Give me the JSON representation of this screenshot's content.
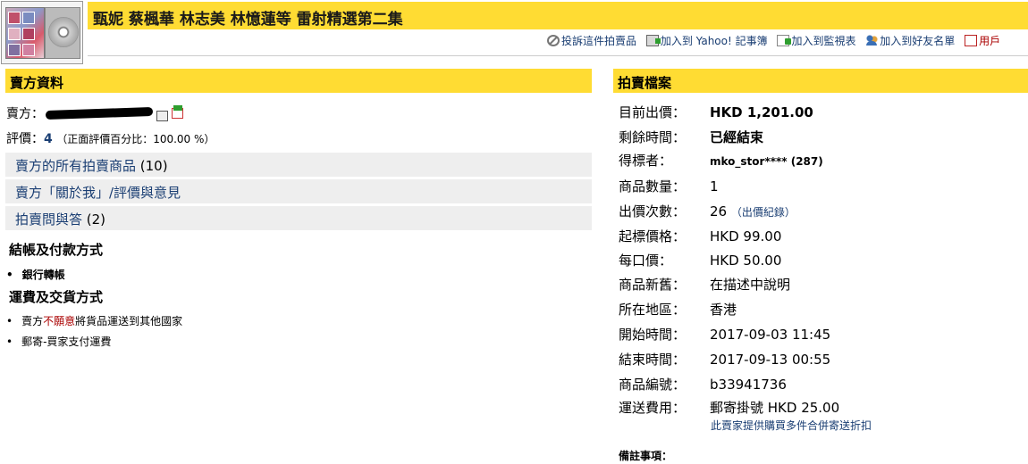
{
  "title": "甄妮 蔡楓華 林志美 林憶蓮等 雷射精選第二集",
  "toolbar": [
    {
      "label": "投訴這件拍賣品",
      "icon": "report-icon"
    },
    {
      "label": "加入到 Yahoo! 記事簿",
      "icon": "notebook-icon"
    },
    {
      "label": "加入到監視表",
      "icon": "watchlist-icon"
    },
    {
      "label": "加入到好友名單",
      "icon": "friend-icon"
    },
    {
      "label": "用戶",
      "icon": "terms-icon"
    }
  ],
  "seller": {
    "heading": "賣方資料",
    "seller_label": "賣方：",
    "rating_label": "評價：",
    "rating_value": "4",
    "rating_pct": "（正面評價百分比：100.00 %）",
    "links": [
      {
        "label": "賣方的所有拍賣商品",
        "count": " (10)"
      },
      {
        "label": "賣方「關於我」/評價與意見",
        "count": ""
      },
      {
        "label": "拍賣問與答",
        "count": " (2)"
      }
    ],
    "payment_heading": "結帳及付款方式",
    "payment_items": [
      "銀行轉帳"
    ],
    "shipping_heading": "運費及交貨方式",
    "shipping_item_1_prefix": "賣方",
    "shipping_item_1_warn": "不願意",
    "shipping_item_1_suffix": "將貨品運送到其他國家",
    "shipping_item_2": "郵寄-買家支付運費"
  },
  "auction": {
    "heading": "拍賣檔案",
    "rows": [
      {
        "key": "目前出價：",
        "value": "HKD 1,201.00"
      },
      {
        "key": "剩餘時間：",
        "value": "已經結束"
      },
      {
        "key": "得標者：",
        "value": "mko_stor**** (287)"
      },
      {
        "key": "商品數量：",
        "value": "1"
      },
      {
        "key": "出價次數：",
        "value": "26",
        "extra": "（出價紀錄）"
      },
      {
        "key": "起標價格：",
        "value": "HKD 99.00"
      },
      {
        "key": "每口價：",
        "value": "HKD 50.00"
      },
      {
        "key": "商品新舊：",
        "value": "在描述中說明"
      },
      {
        "key": "所在地區：",
        "value": "香港"
      },
      {
        "key": "開始時間：",
        "value": "2017-09-03 11:45"
      },
      {
        "key": "結束時間：",
        "value": "2017-09-13 00:55"
      },
      {
        "key": "商品編號：",
        "value": "b33941736"
      },
      {
        "key": "運送費用：",
        "value": "郵寄掛號 HKD 25.00"
      }
    ],
    "combine_discount": "此賣家提供購買多件合併寄送折扣",
    "notes_label": "備註事項："
  }
}
